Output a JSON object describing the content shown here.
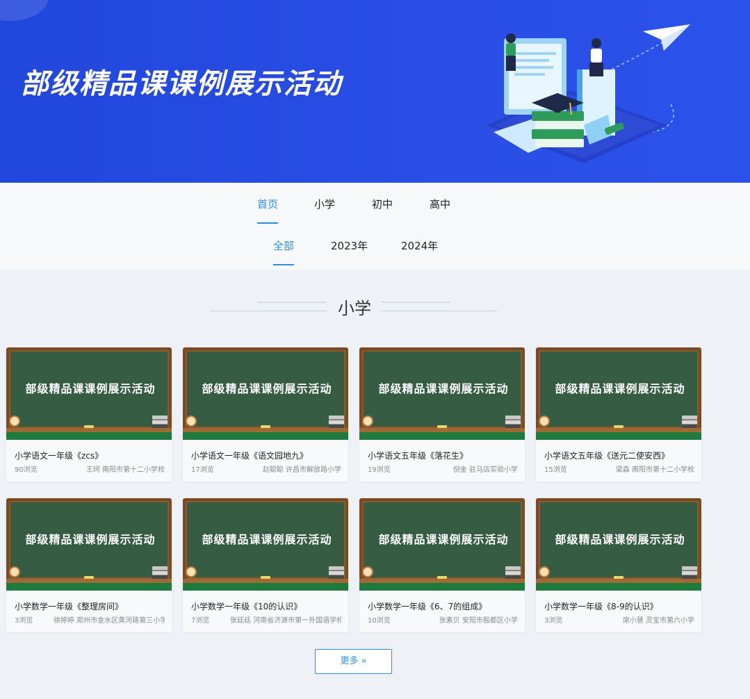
{
  "banner": {
    "title": "部级精品课课例展示活动"
  },
  "nav": {
    "main_tabs": [
      {
        "label": "首页",
        "active": true
      },
      {
        "label": "小学",
        "active": false
      },
      {
        "label": "初中",
        "active": false
      },
      {
        "label": "高中",
        "active": false
      }
    ],
    "year_tabs": [
      {
        "label": "全部",
        "active": true
      },
      {
        "label": "2023年",
        "active": false
      },
      {
        "label": "2024年",
        "active": false
      }
    ]
  },
  "section": {
    "title": "小学"
  },
  "cards": [
    {
      "thumb_text": "部级精品课课例展示活动",
      "title": "小学语文一年级《zcs》",
      "views": "90浏览",
      "author": "王珂  南阳市第十二小学校"
    },
    {
      "thumb_text": "部级精品课课例展示活动",
      "title": "小学语文一年级《语文园地九》",
      "views": "17浏览",
      "author": "赵聪聪  许昌市解放路小学"
    },
    {
      "thumb_text": "部级精品课课例展示活动",
      "title": "小学语文五年级《落花生》",
      "views": "19浏览",
      "author": "倪金  驻马店实验小学"
    },
    {
      "thumb_text": "部级精品课课例展示活动",
      "title": "小学语文五年级《送元二使安西》",
      "views": "15浏览",
      "author": "梁森  南阳市第十二小学校"
    },
    {
      "thumb_text": "部级精品课课例展示活动",
      "title": "小学数学一年级《整理房间》",
      "views": "3浏览",
      "author": "徐婷婷  郑州市金水区黄河路第三小学"
    },
    {
      "thumb_text": "部级精品课课例展示活动",
      "title": "小学数学一年级《10的认识》",
      "views": "7浏览",
      "author": "张廷廷  河南省济源市第一外国语学校"
    },
    {
      "thumb_text": "部级精品课课例展示活动",
      "title": "小学数学一年级《6、7的组成》",
      "views": "10浏览",
      "author": "张素贝  安阳市殷都区小学"
    },
    {
      "thumb_text": "部级精品课课例展示活动",
      "title": "小学数学一年级《8-9的认识》",
      "views": "3浏览",
      "author": "席小慧  灵宝市第六小学"
    }
  ],
  "more_button": {
    "label": "更多 »"
  },
  "colors": {
    "banner_blue": "#2247dc",
    "accent": "#2f8ed9",
    "board_green": "#365c44"
  },
  "icons": [
    "graduation-scene-illustration",
    "paper-plane-icon",
    "clock-icon",
    "books-icon",
    "chalk-icon",
    "double-chevron-right-icon"
  ]
}
